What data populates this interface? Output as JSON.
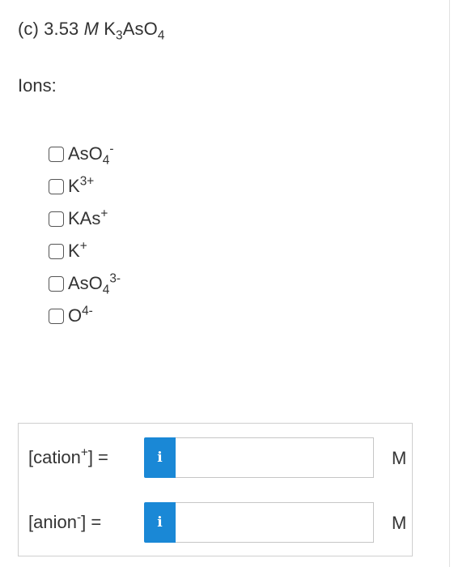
{
  "question": {
    "part": "(c)",
    "concentration": "3.53",
    "unit": "M",
    "formula": {
      "k": "K",
      "k_sub": "3",
      "as": "AsO",
      "o_sub": "4"
    }
  },
  "ions_label": "Ions:",
  "options": [
    {
      "base": "AsO",
      "sub": "4",
      "sup": "-"
    },
    {
      "base": "K",
      "sub": "",
      "sup": "3+"
    },
    {
      "base": "KAs",
      "sub": "",
      "sup": "+"
    },
    {
      "base": "K",
      "sub": "",
      "sup": "+"
    },
    {
      "base": "AsO",
      "sub": "4",
      "sup": "3-"
    },
    {
      "base": "O",
      "sub": "",
      "sup": "4-"
    }
  ],
  "answers": {
    "cation": {
      "open": "[cation",
      "sup": "+",
      "close": "] =",
      "info_icon": "i",
      "value": "",
      "unit": "M"
    },
    "anion": {
      "open": "[anion",
      "sup": "-",
      "close": "] =",
      "info_icon": "i",
      "value": "",
      "unit": "M"
    }
  },
  "colors": {
    "info_button": "#1a88d6",
    "text": "#333333"
  }
}
